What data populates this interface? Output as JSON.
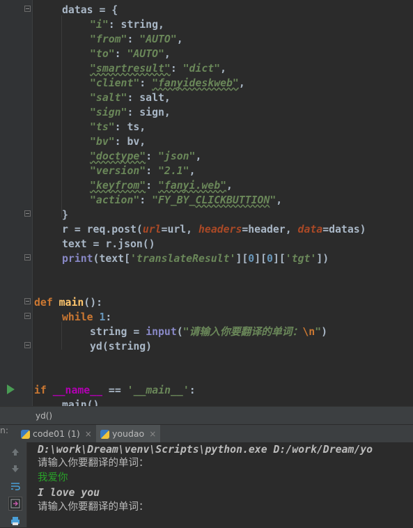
{
  "editor": {
    "lines": [
      {
        "segs": [
          [
            "id",
            "datas = {"
          ]
        ]
      },
      {
        "segs": [
          [
            "str",
            "\"i\""
          ],
          [
            "id",
            ": string,"
          ]
        ]
      },
      {
        "segs": [
          [
            "str",
            "\"from\""
          ],
          [
            "id",
            ": "
          ],
          [
            "str",
            "\"AUTO\""
          ],
          [
            "id",
            ","
          ]
        ]
      },
      {
        "segs": [
          [
            "str",
            "\"to\""
          ],
          [
            "id",
            ": "
          ],
          [
            "str",
            "\"AUTO\""
          ],
          [
            "id",
            ","
          ]
        ]
      },
      {
        "segs": [
          [
            "strw",
            "\"smartresult\""
          ],
          [
            "id",
            ": "
          ],
          [
            "str",
            "\"dict\""
          ],
          [
            "id",
            ","
          ]
        ]
      },
      {
        "segs": [
          [
            "str",
            "\"client\""
          ],
          [
            "id",
            ": "
          ],
          [
            "strw",
            "\"fanyideskweb\""
          ],
          [
            "id",
            ","
          ]
        ]
      },
      {
        "segs": [
          [
            "str",
            "\"salt\""
          ],
          [
            "id",
            ": salt,"
          ]
        ]
      },
      {
        "segs": [
          [
            "str",
            "\"sign\""
          ],
          [
            "id",
            ": sign,"
          ]
        ]
      },
      {
        "segs": [
          [
            "str",
            "\"ts\""
          ],
          [
            "id",
            ": ts,"
          ]
        ]
      },
      {
        "segs": [
          [
            "str",
            "\"bv\""
          ],
          [
            "id",
            ": bv,"
          ]
        ]
      },
      {
        "segs": [
          [
            "strw",
            "\"doctype\""
          ],
          [
            "id",
            ": "
          ],
          [
            "str",
            "\"json\""
          ],
          [
            "id",
            ","
          ]
        ]
      },
      {
        "segs": [
          [
            "str",
            "\"version\""
          ],
          [
            "id",
            ": "
          ],
          [
            "str",
            "\"2.1\""
          ],
          [
            "id",
            ","
          ]
        ]
      },
      {
        "segs": [
          [
            "strw",
            "\"keyfrom\""
          ],
          [
            "id",
            ": "
          ],
          [
            "strw",
            "\"fanyi.web\""
          ],
          [
            "id",
            ","
          ]
        ]
      },
      {
        "segs": [
          [
            "str",
            "\"action\""
          ],
          [
            "id",
            ": "
          ],
          [
            "str",
            "\"FY_BY_"
          ],
          [
            "strw",
            "CLICKBUTTION"
          ],
          [
            "str",
            "\""
          ],
          [
            "id",
            ","
          ]
        ]
      },
      {
        "segs": [
          [
            "id",
            "}"
          ]
        ]
      },
      {
        "segs": [
          [
            "id",
            "r = req.post("
          ],
          [
            "param",
            "url"
          ],
          [
            "id",
            "=url, "
          ],
          [
            "param",
            "headers"
          ],
          [
            "id",
            "=header, "
          ],
          [
            "param",
            "data"
          ],
          [
            "id",
            "=datas)"
          ]
        ]
      },
      {
        "segs": [
          [
            "id",
            "text = r.json()"
          ]
        ]
      },
      {
        "segs": [
          [
            "bi",
            "print"
          ],
          [
            "id",
            "(text["
          ],
          [
            "str",
            "'translateResult'"
          ],
          [
            "id",
            "]["
          ],
          [
            "num",
            "0"
          ],
          [
            "id",
            "]["
          ],
          [
            "num",
            "0"
          ],
          [
            "id",
            "]["
          ],
          [
            "str",
            "'tgt'"
          ],
          [
            "id",
            "])"
          ]
        ]
      },
      {
        "segs": []
      },
      {
        "segs": []
      },
      {
        "segs": [
          [
            "kw",
            "def "
          ],
          [
            "fn",
            "main"
          ],
          [
            "id",
            "():"
          ]
        ]
      },
      {
        "segs": [
          [
            "kw",
            "while "
          ],
          [
            "num",
            "1"
          ],
          [
            "id",
            ":"
          ]
        ]
      },
      {
        "segs": [
          [
            "id",
            "string = "
          ],
          [
            "bi",
            "input"
          ],
          [
            "id",
            "("
          ],
          [
            "str",
            "\"请输入你要翻译的单词："
          ],
          [
            "kw",
            "\\n"
          ],
          [
            "str",
            "\""
          ],
          [
            "id",
            ")"
          ]
        ]
      },
      {
        "segs": [
          [
            "id",
            "yd(string)"
          ]
        ]
      },
      {
        "segs": []
      },
      {
        "segs": []
      },
      {
        "segs": [
          [
            "kw",
            "if "
          ],
          [
            "magic",
            "__name__"
          ],
          [
            "id",
            " == "
          ],
          [
            "str",
            "'__main__'"
          ],
          [
            "id",
            ":"
          ]
        ]
      },
      {
        "segs": [
          [
            "id",
            "main()"
          ]
        ]
      }
    ],
    "indents": [
      1,
      2,
      2,
      2,
      2,
      2,
      2,
      2,
      2,
      2,
      2,
      2,
      2,
      2,
      1,
      1,
      1,
      1,
      0,
      0,
      0,
      1,
      2,
      2,
      0,
      0,
      0,
      1
    ]
  },
  "breadcrumb": {
    "text": "yd()"
  },
  "tabs": [
    {
      "label": "code01 (1)",
      "close": "×"
    },
    {
      "label": "youdao",
      "close": "×"
    }
  ],
  "run_label": "n:",
  "console": {
    "command": "D:\\work\\Dream\\venv\\Scripts\\python.exe D:/work/Dream/yo",
    "prompt1": "请输入你要翻译的单词：",
    "user_input": "我爱你",
    "result": "I love you",
    "prompt2": "请输入你要翻译的单词："
  },
  "icons": [
    "arrow-up-icon",
    "arrow-down-icon",
    "soft-wrap-icon",
    "scroll-to-end-icon",
    "print-icon",
    "run-gutter-icon",
    "python-file-icon"
  ]
}
